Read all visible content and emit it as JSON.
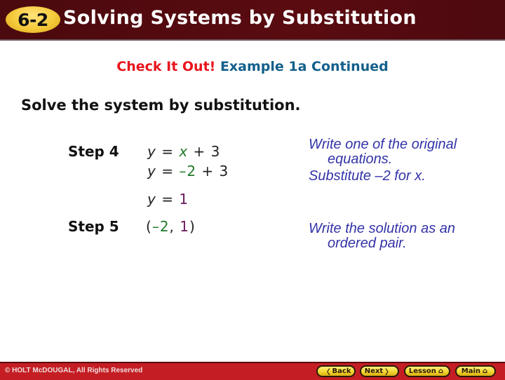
{
  "header": {
    "lesson_badge": "6-2",
    "title": "Solving Systems by Substitution"
  },
  "subtitle": {
    "prefix": "Check It Out!",
    "rest": "Example 1a Continued"
  },
  "instruction": "Solve the system by substitution.",
  "steps": [
    {
      "label": "Step 4",
      "lines": [
        {
          "lhs": "y",
          "eq": "=",
          "parts": [
            {
              "text": "x",
              "color": "green",
              "italic": true
            },
            {
              "text": " + 3",
              "color": "black"
            }
          ]
        },
        {
          "lhs": "y",
          "eq": "=",
          "parts": [
            {
              "text": "–2",
              "color": "green"
            },
            {
              "text": " + 3",
              "color": "black"
            }
          ]
        },
        {
          "lhs": "y",
          "eq": "=",
          "parts": [
            {
              "text": "1",
              "color": "purple"
            }
          ]
        }
      ],
      "notes": [
        "Write one of the original",
        "equations.",
        "Substitute –2 for x."
      ]
    },
    {
      "label": "Step 5",
      "pair": {
        "open": "(",
        "x": "–2",
        "sep": ", ",
        "y": "1",
        "close": ")"
      },
      "notes": [
        "Write the solution as an",
        "ordered pair."
      ]
    }
  ],
  "footer": {
    "copyright": "© HOLT McDOUGAL, All Rights Reserved",
    "buttons": [
      {
        "label": "Back",
        "icon": "chevron-left-icon",
        "glyph": "〈"
      },
      {
        "label": "Next",
        "icon": "chevron-right-icon",
        "glyph": "〉"
      },
      {
        "label": "Lesson",
        "icon": "home-icon",
        "glyph": "⌂"
      },
      {
        "label": "Main",
        "icon": "home-icon",
        "glyph": "⌂"
      }
    ]
  },
  "colors": {
    "header_bg": "#4a0a0e",
    "badge": "#f5c93a",
    "accent_red": "#e8141c",
    "accent_blue": "#135f8c",
    "note_blue": "#3333a8",
    "green": "#1f7a2a",
    "purple": "#6a1a5c",
    "footer_bg": "#c41e24"
  }
}
